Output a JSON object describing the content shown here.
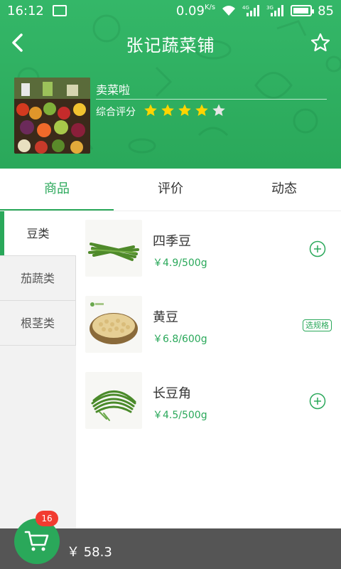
{
  "status_bar": {
    "time": "16:12",
    "speed": "0.09",
    "speed_unit": "K/s",
    "net_4g": "4G",
    "net_3g": "3G",
    "battery": "85"
  },
  "navbar": {
    "title": "张记蔬菜铺"
  },
  "shop": {
    "name": "卖菜啦",
    "rating_label": "综合评分",
    "rating": 4,
    "rating_max": 5
  },
  "tabs": [
    {
      "label": "商品",
      "active": true
    },
    {
      "label": "评价",
      "active": false
    },
    {
      "label": "动态",
      "active": false
    }
  ],
  "categories": [
    {
      "label": "豆类",
      "active": true
    },
    {
      "label": "茄蔬类",
      "active": false
    },
    {
      "label": "根茎类",
      "active": false
    }
  ],
  "products": [
    {
      "name": "四季豆",
      "price": "￥4.9/500g",
      "action": "add"
    },
    {
      "name": "黄豆",
      "price": "￥6.8/600g",
      "action": "spec",
      "spec_label": "选规格"
    },
    {
      "name": "长豆角",
      "price": "￥4.5/500g",
      "action": "add"
    }
  ],
  "cart": {
    "count": "16",
    "total": "￥ 58.3"
  },
  "colors": {
    "primary": "#2aa85a",
    "header": "#34b768",
    "badge": "#f23b30",
    "cartbar": "#555555",
    "star": "#ffd400",
    "star_empty": "#e6e6e6"
  }
}
